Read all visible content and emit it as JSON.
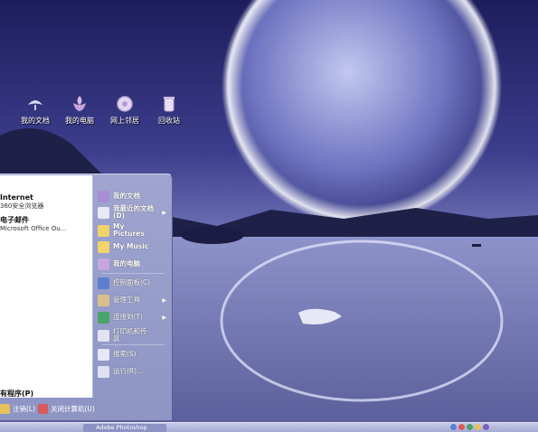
{
  "desktop": {
    "icons": [
      {
        "label": "我的文档"
      },
      {
        "label": "我的电脑"
      },
      {
        "label": "网上邻居"
      },
      {
        "label": "回收站"
      }
    ]
  },
  "start_menu": {
    "pinned": [
      {
        "title": "Internet",
        "subtitle": "360安全浏览器"
      },
      {
        "title": "电子邮件",
        "subtitle": "Microsoft Office Ou..."
      }
    ],
    "all_programs": "有程序(P)",
    "right_items": [
      {
        "label": "我的文档",
        "icon": "folder-docs-icon"
      },
      {
        "label": "我最近的文档(D)",
        "icon": "recent-docs-icon",
        "arrow": "▶"
      },
      {
        "label": "My Pictures",
        "icon": "pictures-icon"
      },
      {
        "label": "My Music",
        "icon": "music-icon"
      },
      {
        "label": "我的电脑",
        "icon": "computer-icon"
      },
      {
        "label": "控制面板(C)",
        "icon": "control-panel-icon"
      },
      {
        "label": "管理工具",
        "icon": "admin-tools-icon",
        "arrow": "▶"
      },
      {
        "label": "连接到(T)",
        "icon": "connect-icon",
        "arrow": "▶"
      },
      {
        "label": "打印机和传真",
        "icon": "printer-icon"
      },
      {
        "label": "搜索(S)",
        "icon": "search-icon"
      },
      {
        "label": "运行(R)...",
        "icon": "run-icon"
      }
    ],
    "logoff": "注销(L)",
    "shutdown": "关闭计算机(U)"
  },
  "taskbar": {
    "active_window": "Adobe Photoshop"
  },
  "colors": {
    "start_menu_bg": "#9399c9",
    "taskbar_bg": "#b5b9de"
  }
}
